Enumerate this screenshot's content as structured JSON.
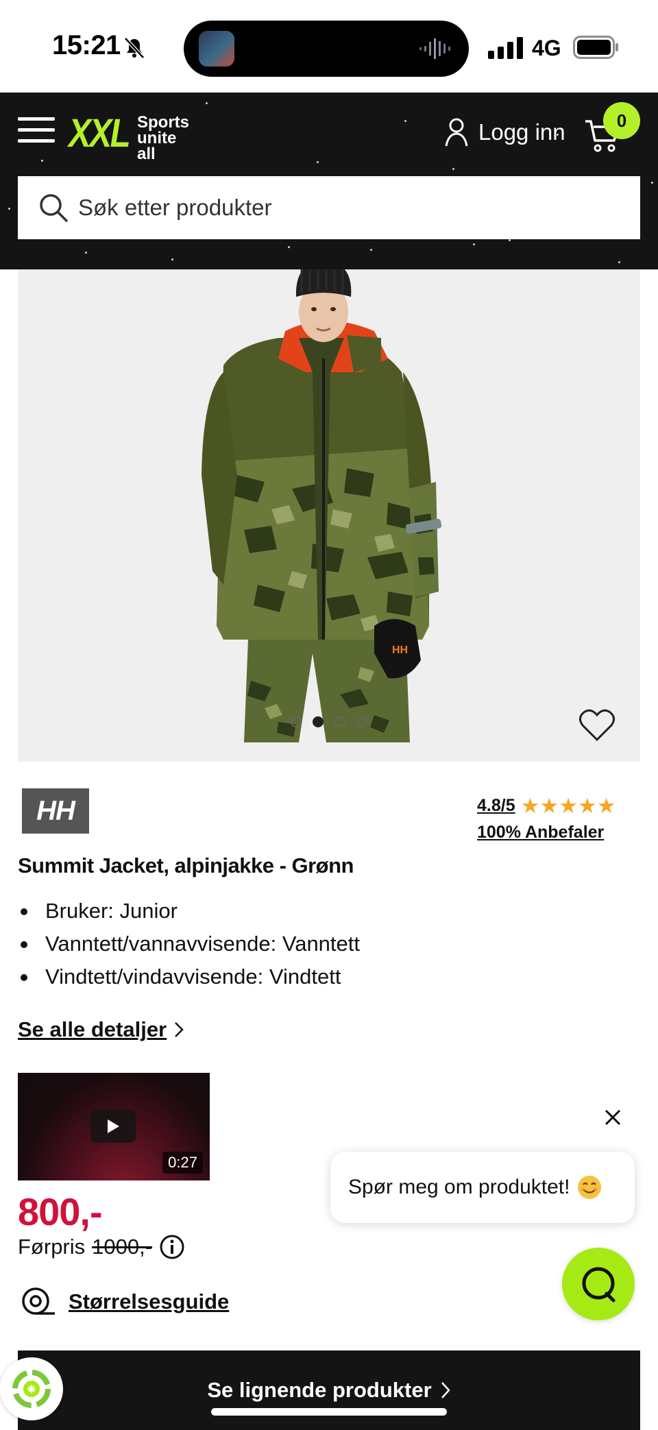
{
  "status_bar": {
    "time": "15:21",
    "network": "4G"
  },
  "header": {
    "logo_text": "XXL",
    "logo_tagline": "Sports\nunite all",
    "login_label": "Logg inn",
    "cart_count": "0",
    "search_placeholder": "Søk etter produkter",
    "accent_color": "#b4f02a"
  },
  "gallery": {
    "image_count": 5,
    "active_index": 1
  },
  "product": {
    "brand": "HH",
    "rating": "4.8/5",
    "stars": 5,
    "recommend": "100% Anbefaler",
    "title": "Summit Jacket, alpinjakke - Grønn",
    "features": [
      "Bruker: Junior",
      "Vanntett/vannavvisende: Vanntett",
      "Vindtett/vindavvisende: Vindtett"
    ],
    "details_link": "Se alle detaljer",
    "video_duration": "0:27",
    "price": "800,-",
    "prev_price_label": "Førpris",
    "prev_price": "1000,-",
    "size_guide": "Størrelsesguide",
    "price_color": "#d2113a"
  },
  "chat": {
    "prompt": "Spør meg om produktet!",
    "button_color": "#a6ea15"
  },
  "footer": {
    "similar_label": "Se lignende produkter"
  }
}
